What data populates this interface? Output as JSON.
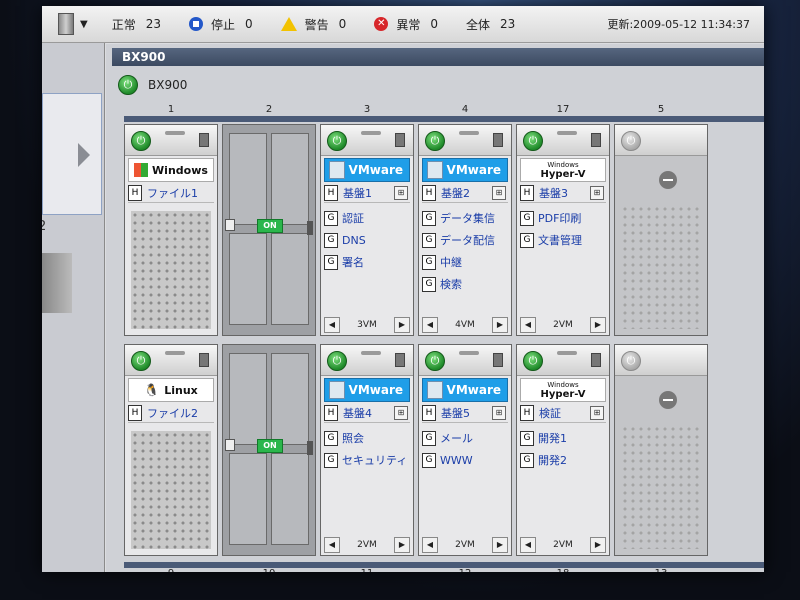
{
  "statusbar": {
    "normal_label": "正常",
    "normal_count": "23",
    "stopped_label": "停止",
    "stopped_count": "0",
    "warning_label": "警告",
    "warning_count": "0",
    "error_label": "異常",
    "error_count": "0",
    "total_label": "全体",
    "total_count": "23",
    "updated_label": "更新:",
    "updated_value": "2009-05-12 11:34:37"
  },
  "leftpanel": {
    "partial_number": "2"
  },
  "main": {
    "frame_title": "BX900",
    "chassis_name": "BX900"
  },
  "slots_top": [
    "1",
    "2",
    "3",
    "4",
    "17",
    "5"
  ],
  "slots_bottom": [
    "9",
    "10",
    "11",
    "12",
    "18",
    "13"
  ],
  "blades": [
    {
      "os": "Windows",
      "host": "ファイル1"
    },
    {
      "status": "ON"
    },
    {
      "os": "VMware",
      "host": "基盤1",
      "vms": [
        "認証",
        "DNS",
        "署名"
      ],
      "vm_count": "3VM"
    },
    {
      "os": "VMware",
      "host": "基盤2",
      "vms": [
        "データ集信",
        "データ配信",
        "中継",
        "検索"
      ],
      "vm_count": "4VM"
    },
    {
      "os_small": "Windows",
      "os": "Hyper-V",
      "host": "基盤3",
      "vms": [
        "PDF印刷",
        "文書管理"
      ],
      "vm_count": "2VM"
    },
    {},
    {
      "os": "Linux",
      "host": "ファイル2"
    },
    {
      "status": "ON"
    },
    {
      "os": "VMware",
      "host": "基盤4",
      "vms": [
        "照会",
        "セキュリティ"
      ],
      "vm_count": "2VM"
    },
    {
      "os": "VMware",
      "host": "基盤5",
      "vms": [
        "メール",
        "WWW"
      ],
      "vm_count": "2VM"
    },
    {
      "os_small": "Windows",
      "os": "Hyper-V",
      "host": "検証",
      "vms": [
        "開発1",
        "開発2"
      ],
      "vm_count": "2VM"
    },
    {}
  ],
  "colors": {
    "vmware_badge": "#1f9ee8",
    "power_on": "#1f8a2a",
    "on_tag": "#2bb64c",
    "frame_title": "#3c4a61",
    "link_text": "#1a3da8"
  }
}
